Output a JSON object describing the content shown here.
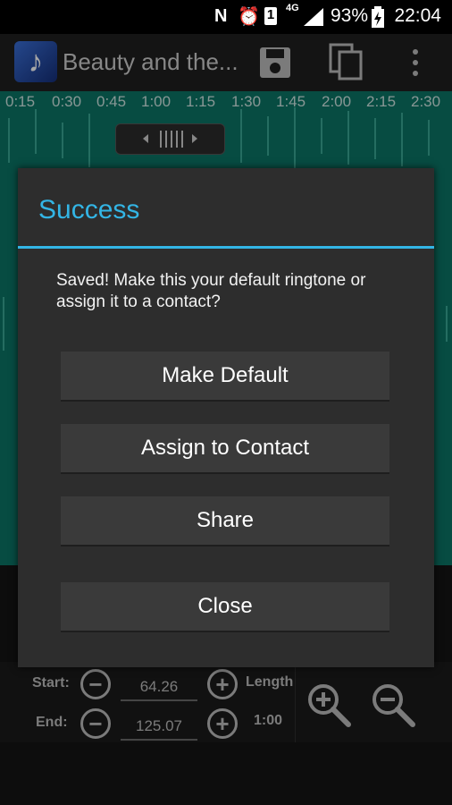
{
  "status_bar": {
    "network": "4G",
    "sim": "1",
    "battery_percent": "93%",
    "time": "22:04"
  },
  "action_bar": {
    "title": "Beauty and the..."
  },
  "timeline": {
    "ticks": [
      "0:15",
      "0:30",
      "0:45",
      "1:00",
      "1:15",
      "1:30",
      "1:45",
      "2:00",
      "2:15",
      "2:30"
    ]
  },
  "controls": {
    "start_label": "Start:",
    "end_label": "End:",
    "start_value": "64.26",
    "end_value": "125.07",
    "length_label": "Length",
    "length_value": "1:00"
  },
  "dialog": {
    "title": "Success",
    "message": "Saved! Make this your default ringtone or assign it to a contact?",
    "buttons": {
      "make_default": "Make Default",
      "assign": "Assign to Contact",
      "share": "Share",
      "close": "Close"
    }
  },
  "colors": {
    "accent": "#33b5e5",
    "waveform_bg": "#0b7566"
  }
}
